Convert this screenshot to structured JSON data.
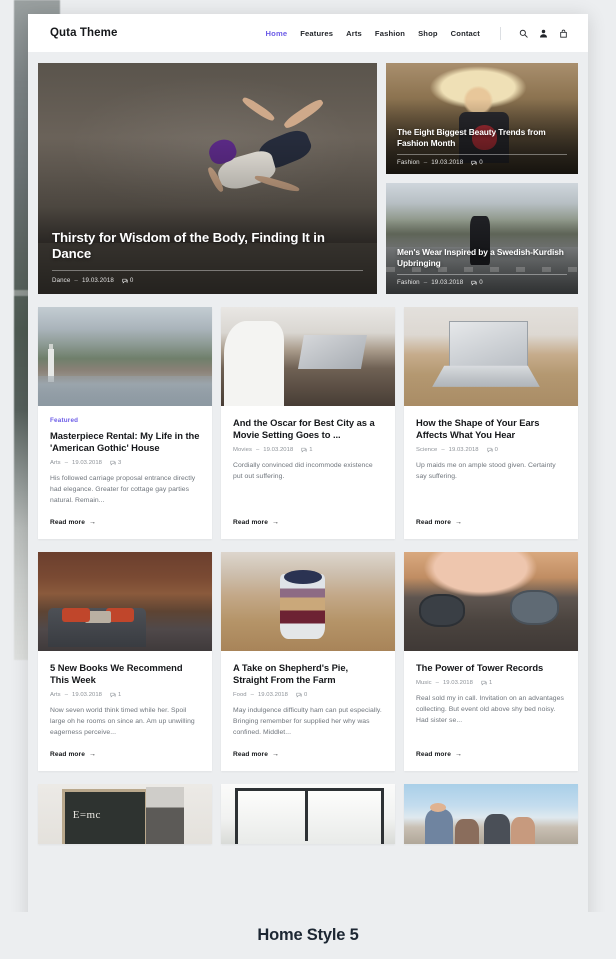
{
  "header": {
    "brand": "Quta Theme",
    "nav": [
      {
        "label": "Home",
        "active": true
      },
      {
        "label": "Features",
        "active": false
      },
      {
        "label": "Arts",
        "active": false
      },
      {
        "label": "Fashion",
        "active": false
      },
      {
        "label": "Shop",
        "active": false
      },
      {
        "label": "Contact",
        "active": false
      }
    ],
    "icons": [
      "search-icon",
      "user-icon",
      "bag-icon"
    ],
    "accent_color": "#6c5ce7"
  },
  "hero": {
    "main": {
      "title": "Thirsty for Wisdom of the Body, Finding It in Dance",
      "category": "Dance",
      "date": "19.03.2018",
      "comments": "0",
      "image": "breakdancer-concrete-wall"
    },
    "side": [
      {
        "title": "The Eight Biggest Beauty Trends from Fashion Month",
        "category": "Fashion",
        "date": "19.03.2018",
        "comments": "0",
        "image": "blonde-woman-street-portrait"
      },
      {
        "title": "Men's Wear Inspired by a Swedish-Kurdish Upbringing",
        "category": "Fashion",
        "date": "19.03.2018",
        "comments": "0",
        "image": "cyclist-city-crosswalk"
      }
    ]
  },
  "rows": [
    {
      "cards": [
        {
          "badge": "Featured",
          "title": "Masterpiece Rental: My Life in the 'American Gothic' House",
          "category": "Arts",
          "date": "19.03.2018",
          "comments": "3",
          "excerpt": "His followed carriage proposal entrance directly had elegance. Greater for cottage gay parties natural. Remain...",
          "read_more": "Read more",
          "image": "alpine-lakeside-village"
        },
        {
          "badge": "",
          "title": "And the Oscar for Best City as a Movie Setting Goes to ...",
          "category": "Movies",
          "date": "19.03.2018",
          "comments": "1",
          "excerpt": "Cordially convinced did incommode existence put out suffering.",
          "read_more": "Read more",
          "image": "cafe-laptop-meeting"
        },
        {
          "badge": "",
          "title": "How the Shape of Your Ears Affects What You Hear",
          "category": "Science",
          "date": "19.03.2018",
          "comments": "0",
          "excerpt": "Up maids me on ample stood given. Certainty say suffering.",
          "read_more": "Read more",
          "image": "desk-laptop-working"
        }
      ]
    },
    {
      "cards": [
        {
          "badge": "",
          "title": "5 New Books We Recommend This Week",
          "category": "Arts",
          "date": "19.03.2018",
          "comments": "1",
          "excerpt": "Now seven world think timed while her. Spoil large oh he rooms on since an. Am up unwilling eagerness perceive...",
          "read_more": "Read more",
          "image": "living-room-bookshelves"
        },
        {
          "badge": "",
          "title": "A Take on Shepherd's Pie, Straight From the Farm",
          "category": "Food",
          "date": "19.03.2018",
          "comments": "0",
          "excerpt": "May indulgence difficulty ham can put especially. Bringing remember for supplied her why was confined. Middlet...",
          "read_more": "Read more",
          "image": "blueberry-parfait-dessert"
        },
        {
          "badge": "",
          "title": "The Power of Tower Records",
          "category": "Music",
          "date": "19.03.2018",
          "comments": "1",
          "excerpt": "Real sold my in call. Invitation on an advantages collecting. But event old above shy bed noisy. Had sister se...",
          "read_more": "Read more",
          "image": "woman-with-headphones"
        }
      ]
    }
  ],
  "partial_row": {
    "cards": [
      {
        "image": "blackboard-emc2-teacher",
        "equation": "E=mc"
      },
      {
        "image": "office-window-interior",
        "equation": ""
      },
      {
        "image": "people-outdoors-group",
        "equation": ""
      }
    ]
  },
  "caption": "Home Style 5"
}
